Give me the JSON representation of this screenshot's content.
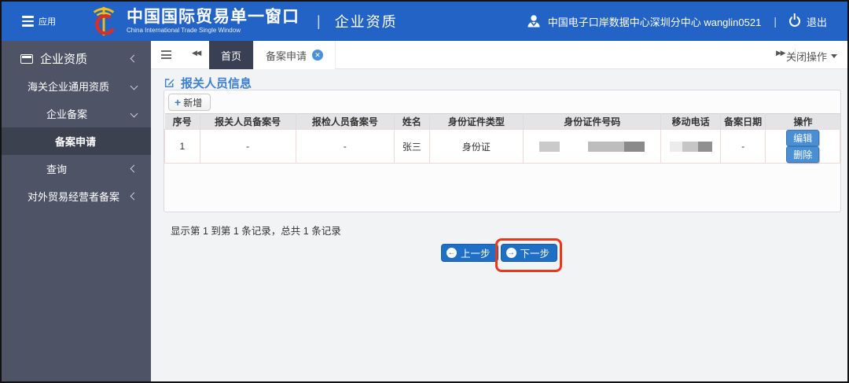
{
  "header": {
    "menu_label": "应用",
    "brand_title": "中国国际贸易单一窗口",
    "brand_subtitle": "China International Trade Single Window",
    "divider": "|",
    "app_title": "企业资质",
    "user_org": "中国电子口岸数据中心深圳分中心 wanglin0521",
    "user_divider": "|",
    "logout_label": "退出"
  },
  "sidebar": {
    "items": [
      {
        "label": "企业资质",
        "level": 0,
        "chevron": "collapsed",
        "active": false,
        "has_icon": true
      },
      {
        "label": "海关企业通用资质",
        "level": 1,
        "chevron": "expanded",
        "active": false,
        "has_icon": false
      },
      {
        "label": "企业备案",
        "level": 2,
        "chevron": "expanded",
        "active": false,
        "has_icon": false
      },
      {
        "label": "备案申请",
        "level": 3,
        "chevron": "none",
        "active": true,
        "has_icon": false
      },
      {
        "label": "查询",
        "level": 2,
        "chevron": "collapsed",
        "active": false,
        "has_icon": false
      },
      {
        "label": "对外贸易经营者备案",
        "level": 1,
        "chevron": "collapsed",
        "active": false,
        "has_icon": false
      }
    ]
  },
  "tabbar": {
    "tabs": [
      {
        "label": "首页",
        "active": true,
        "closable": false
      },
      {
        "label": "备案申请",
        "active": false,
        "closable": true
      }
    ],
    "close_menu_label": "关闭操作"
  },
  "main": {
    "section_title": "报关人员信息",
    "add_button_label": "新增",
    "table": {
      "headers": [
        "序号",
        "报关人员备案号",
        "报检人员备案号",
        "姓名",
        "身份证件类型",
        "身份证件号码",
        "移动电话",
        "备案日期",
        "操作"
      ],
      "rows": [
        {
          "seq": "1",
          "customs_declarant_no": "-",
          "inspection_declarant_no": "-",
          "name": "张三",
          "id_type": "身份证",
          "id_number_redacted": true,
          "mobile_redacted": true,
          "record_date": "-",
          "edit_label": "编辑",
          "delete_label": "删除"
        }
      ]
    },
    "pagination_text": "显示第 1 到第 1 条记录，总共 1 条记录",
    "prev_label": "上一步",
    "next_label": "下一步"
  },
  "colors": {
    "header_blue": "#2263c5",
    "sidebar_bg": "#4e5366",
    "sidebar_active_bg": "#3c4150",
    "active_tab_bg": "#3a4053",
    "accent_blue": "#3e80cc",
    "action_button_blue": "#4a8fd3",
    "step_button_blue": "#1f6fc4",
    "annotation_red": "#e8391a",
    "table_header_bg": "#e4e4e7"
  }
}
